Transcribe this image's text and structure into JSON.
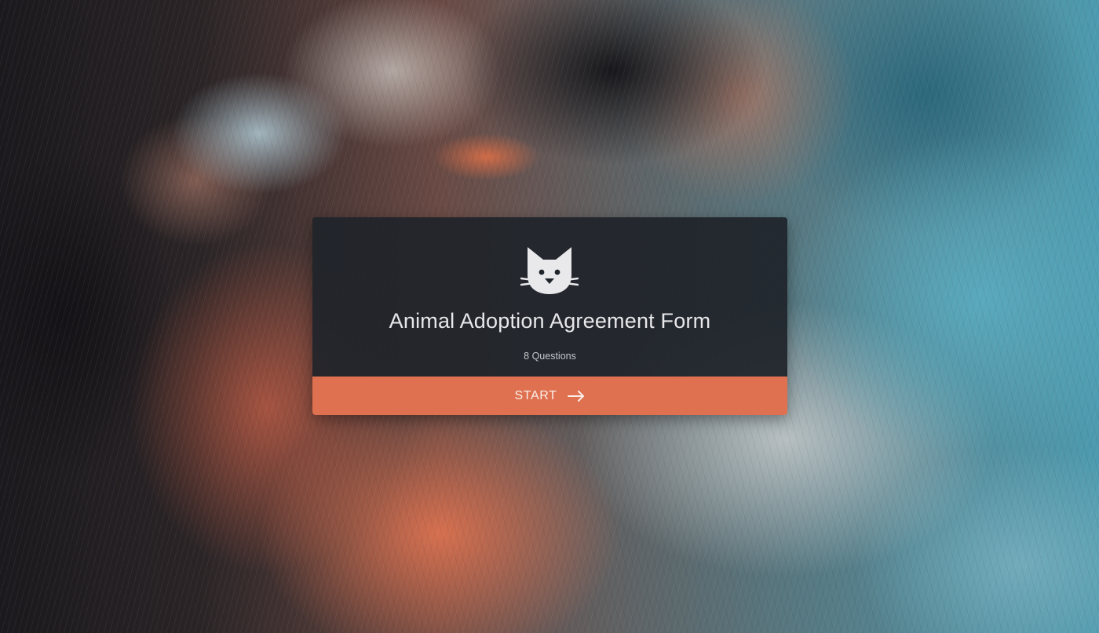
{
  "form": {
    "title": "Animal Adoption Agreement Form",
    "question_count": "8 Questions",
    "start_label": "START",
    "logo_icon": "cat-face-icon",
    "start_icon": "arrow-right-icon"
  },
  "colors": {
    "card_background": "#1f242a",
    "accent": "#df7150",
    "title_text": "#e8e8ea"
  }
}
